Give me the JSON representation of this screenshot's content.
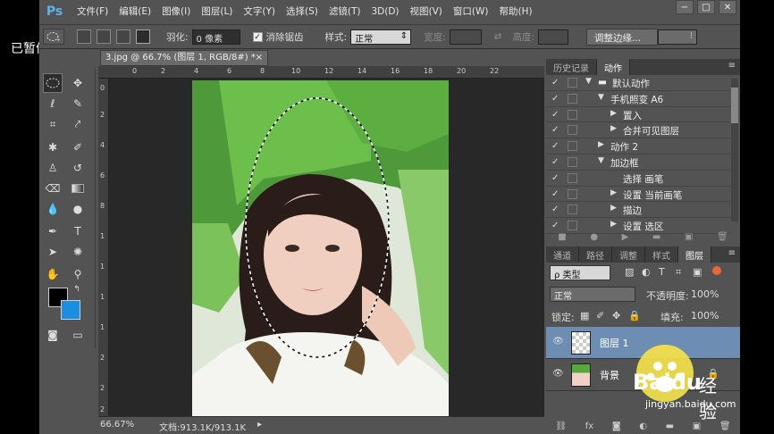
{
  "overlay_status": "已暂停",
  "menubar": {
    "logo": "Ps",
    "items": [
      "文件(F)",
      "编辑(E)",
      "图像(I)",
      "图层(L)",
      "文字(Y)",
      "选择(S)",
      "滤镜(T)",
      "3D(D)",
      "视图(V)",
      "窗口(W)",
      "帮助(H)"
    ],
    "window_controls": [
      "−",
      "□",
      "✕"
    ]
  },
  "options": {
    "feather_label": "羽化:",
    "feather_value": "0 像素",
    "antialias_label": "消除锯齿",
    "antialias_check": "✓",
    "style_label": "样式:",
    "style_value": "正常",
    "width_label": "宽度:",
    "height_label": "高度:",
    "refine_button": "调整边缘..."
  },
  "document": {
    "tab_title": "3.jpg @ 66.7% (图层 1, RGB/8#) *",
    "close": "×",
    "ruler_h": [
      "0",
      "2",
      "4",
      "6",
      "8",
      "10",
      "12",
      "14",
      "16",
      "18",
      "20",
      "22"
    ],
    "ruler_v": [
      "0",
      "2",
      "4",
      "6",
      "8",
      "1",
      "1",
      "1",
      "1",
      "2",
      "2",
      "2"
    ],
    "zoom": "66.67%",
    "doc_size": "文档:913.1K/913.1K"
  },
  "history_panel": {
    "tabs": [
      "历史记录",
      "动作"
    ],
    "actions": [
      {
        "label": "默认动作",
        "indent": 0,
        "expanded": true,
        "folder": true
      },
      {
        "label": "手机照变 A6",
        "indent": 1,
        "expanded": true
      },
      {
        "label": "置入",
        "indent": 2,
        "expanded": false
      },
      {
        "label": "合并可见图层",
        "indent": 2,
        "expanded": false
      },
      {
        "label": "动作 2",
        "indent": 1,
        "expanded": false
      },
      {
        "label": "加边框",
        "indent": 1,
        "expanded": true
      },
      {
        "label": "选择 画笔",
        "indent": 2,
        "expanded": null
      },
      {
        "label": "设置 当前画笔",
        "indent": 2,
        "expanded": false
      },
      {
        "label": "描边",
        "indent": 2,
        "expanded": false
      },
      {
        "label": "设置 选区",
        "indent": 2,
        "expanded": false
      }
    ]
  },
  "layers_panel": {
    "tabs": [
      "通道",
      "路径",
      "调整",
      "样式",
      "图层"
    ],
    "filter_label": "ρ 类型",
    "blend_mode": "正常",
    "opacity_label": "不透明度:",
    "opacity_value": "100%",
    "lock_label": "锁定:",
    "fill_label": "填充:",
    "fill_value": "100%",
    "layers": [
      {
        "name": "图层 1",
        "selected": true
      },
      {
        "name": "背景",
        "selected": false
      }
    ],
    "footer_icons": [
      "link-icon",
      "fx-icon",
      "mask-icon",
      "adjustment-icon",
      "folder-icon",
      "new-layer-icon",
      "trash-icon"
    ]
  },
  "watermark": {
    "brand": "Baidu",
    "cn": "经验",
    "url": "jingyan.baidu.com"
  }
}
